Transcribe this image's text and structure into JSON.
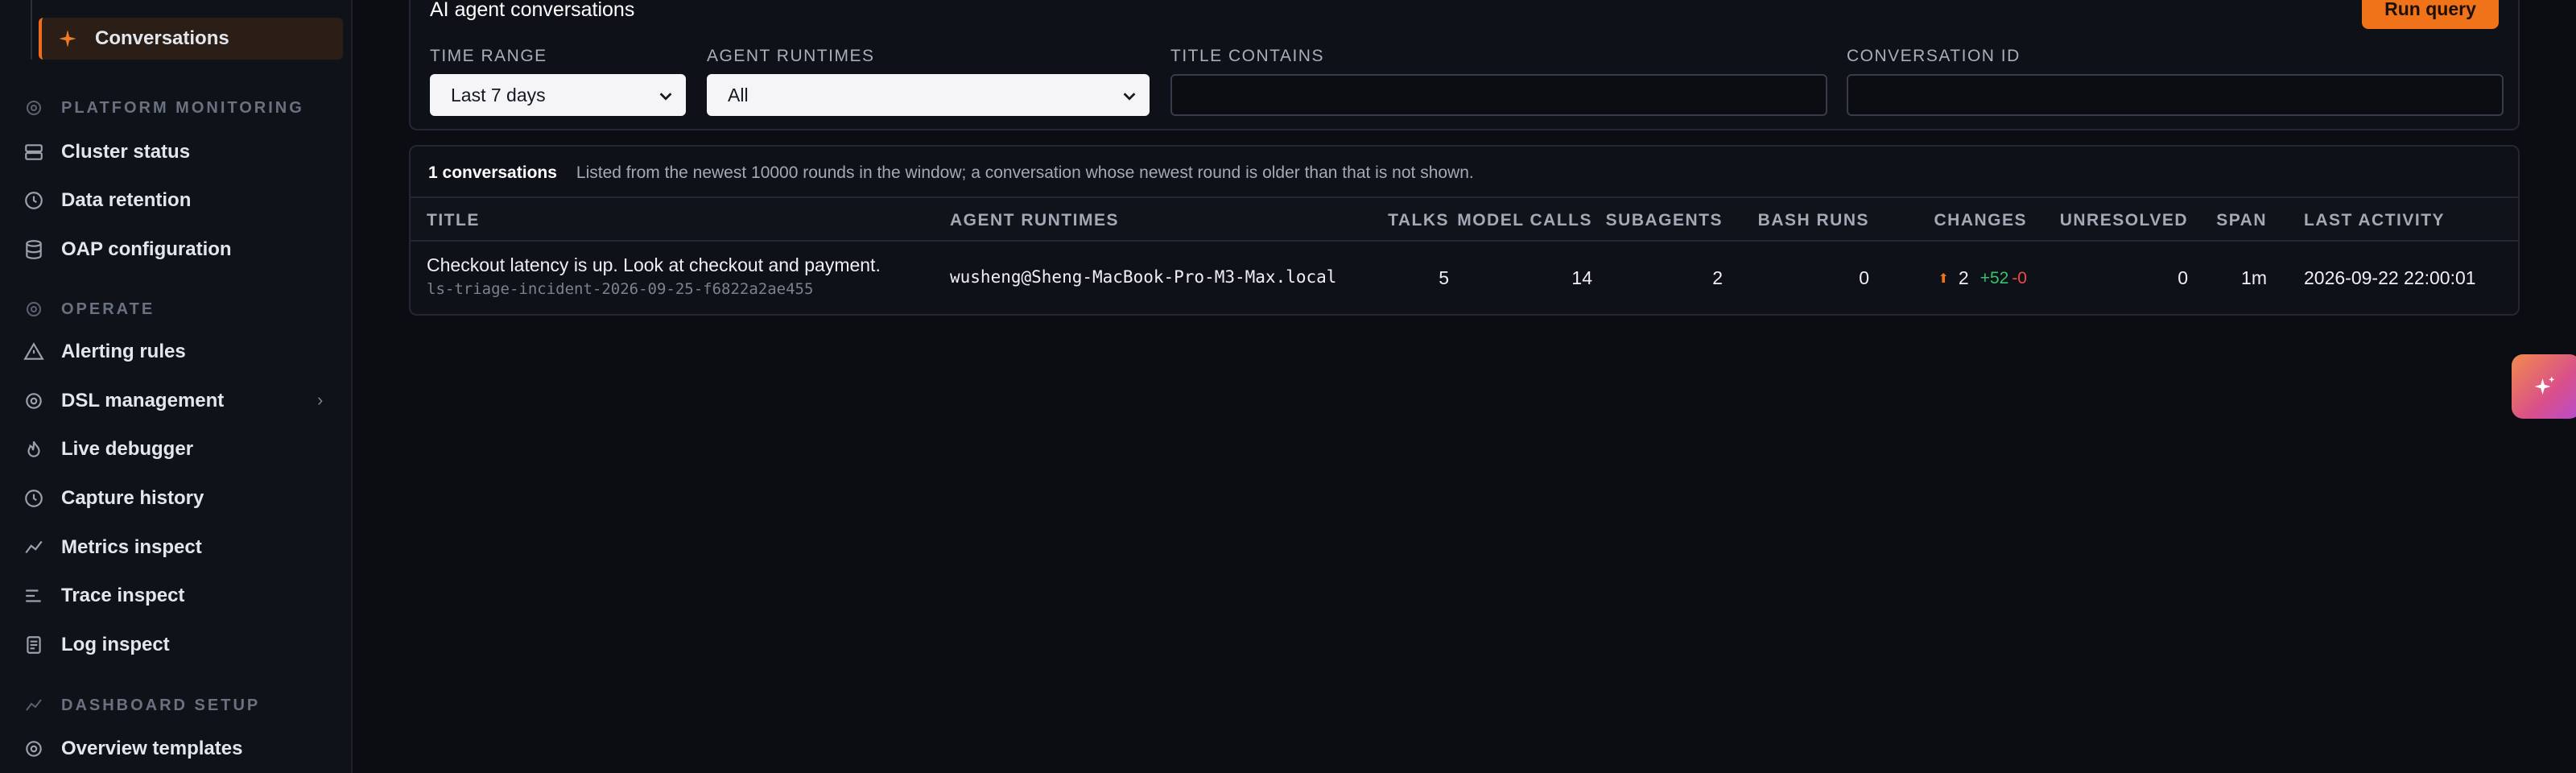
{
  "sidebar": {
    "active_item": "Conversations",
    "sections": [
      {
        "title": "PLATFORM MONITORING",
        "icon": "gear-icon",
        "items": [
          {
            "label": "Cluster status",
            "icon": "server-icon"
          },
          {
            "label": "Data retention",
            "icon": "clock-icon"
          },
          {
            "label": "OAP configuration",
            "icon": "database-icon"
          }
        ]
      },
      {
        "title": "OPERATE",
        "icon": "gear-icon",
        "items": [
          {
            "label": "Alerting rules",
            "icon": "warning-icon"
          },
          {
            "label": "DSL management",
            "icon": "gear-icon"
          },
          {
            "label": "Live debugger",
            "icon": "flame-icon"
          },
          {
            "label": "Capture history",
            "icon": "clock-icon"
          },
          {
            "label": "Metrics inspect",
            "icon": "chart-line-icon"
          },
          {
            "label": "Trace inspect",
            "icon": "trace-lines-icon"
          },
          {
            "label": "Log inspect",
            "icon": "document-icon"
          }
        ]
      },
      {
        "title": "DASHBOARD SETUP",
        "icon": "chart-line-icon",
        "items": [
          {
            "label": "Overview templates",
            "icon": "gear-icon"
          }
        ]
      }
    ]
  },
  "filters": {
    "title": "AI agent conversations",
    "run_label": "Run query",
    "time_range": {
      "label": "TIME RANGE",
      "value": "Last 7 days"
    },
    "agent_runtimes": {
      "label": "AGENT RUNTIMES",
      "value": "All"
    },
    "title_contains": {
      "label": "TITLE CONTAINS",
      "value": ""
    },
    "conversation_id": {
      "label": "CONVERSATION ID",
      "value": ""
    }
  },
  "results": {
    "count_label": "1 conversations",
    "note": "Listed from the newest 10000 rounds in the window; a conversation whose newest round is older than that is not shown.",
    "columns": [
      "TITLE",
      "AGENT RUNTIMES",
      "TALKS",
      "MODEL CALLS",
      "SUBAGENTS",
      "BASH RUNS",
      "CHANGES",
      "UNRESOLVED",
      "SPAN",
      "LAST ACTIVITY"
    ],
    "rows": [
      {
        "title": "Checkout latency is up. Look at checkout and payment.",
        "conversation_id": "ls-triage-incident-2026-09-25-f6822a2ae455",
        "agent_runtime": "wusheng@Sheng-MacBook-Pro-M3-Max.local",
        "talks": "5",
        "model_calls": "14",
        "subagents": "2",
        "bash_runs": "0",
        "changes_files": "2",
        "changes_added": "+52",
        "changes_removed": "-0",
        "unresolved": "0",
        "span": "1m",
        "last_activity": "2026-09-22 22:00:01"
      }
    ]
  },
  "colors": {
    "accent": "#f07219",
    "background": "#0b0d12",
    "added": "#35c46a",
    "removed": "#ef4a4a"
  }
}
